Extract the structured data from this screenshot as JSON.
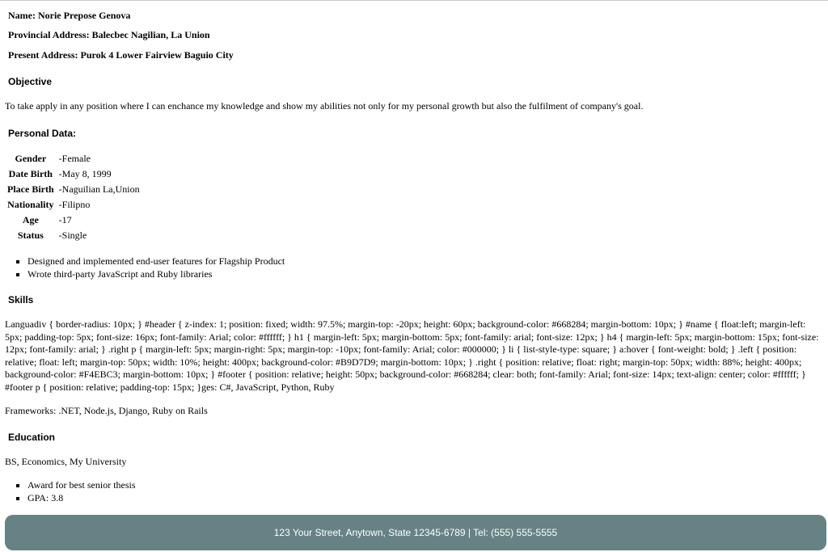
{
  "header": {
    "name": "Name: Norie Prepose Genova",
    "provincial_address": "Provincial Address: Balecbec Nagilian, La Union",
    "present_address": "Present Address: Purok 4 Lower Fairview Baguio City"
  },
  "objective": {
    "title": "Objective",
    "text": "To take apply in any position where I can enchance my knowledge and show my abilities not only for my personal growth but also the fulfilment of company's goal."
  },
  "personal": {
    "title": "Personal Data:",
    "rows": [
      {
        "label": "Gender",
        "value": "-Female"
      },
      {
        "label": "Date Birth",
        "value": "-May 8, 1999"
      },
      {
        "label": "Place Birth",
        "value": "-Naguilian La,Union"
      },
      {
        "label": "Nationality",
        "value": "-Filipno"
      },
      {
        "label": "Age",
        "value": "-17"
      },
      {
        "label": "Status",
        "value": "-Single"
      }
    ],
    "bullets": [
      "Designed and implemented end-user features for Flagship Product",
      "Wrote third-party JavaScript and Ruby libraries"
    ]
  },
  "skills": {
    "title": "Skills",
    "languages_text": "Languadiv { border-radius: 10px; } #header { z-index: 1; position: fixed; width: 97.5%; margin-top: -20px; height: 60px; background-color: #668284; margin-bottom: 10px; } #name { float:left; margin-left: 5px; padding-top: 5px; font-size: 16px; font-family: Arial; color: #ffffff; } h1 { margin-left: 5px; margin-bottom: 5px; font-family: arial; font-size: 12px; } h4 { margin-left: 5px; margin-bottom: 15px; font-size: 12px; font-family: arial; } .right p { margin-left: 5px; margin-right: 5px; margin-top: -10px; font-family: Arial; color: #000000; } li { list-style-type: square; } a:hover { font-weight: bold; } .left { position: relative; float: left; margin-top: 50px; width: 10%; height: 400px; background-color: #B9D7D9; margin-bottom: 10px; } .right { position: relative; float: right; margin-top: 50px; width: 88%; height: 400px; background-color: #F4EBC3; margin-bottom: 10px; } #footer { position: relative; height: 50px; background-color: #668284; clear: both; font-family: Arial; font-size: 14px; text-align: center; color: #ffffff; } #footer p { position: relative; padding-top: 15px; }ges: C#, JavaScript, Python, Ruby",
    "frameworks_text": "Frameworks: .NET, Node.js, Django, Ruby on Rails"
  },
  "education": {
    "title": "Education",
    "degree": "BS, Economics, My University",
    "bullets": [
      "Award for best senior thesis",
      "GPA: 3.8"
    ]
  },
  "footer": {
    "text": "123 Your Street, Anytown, State 12345-6789 | Tel: (555) 555-5555"
  },
  "colors": {
    "footer_bg": "#668284",
    "footer_text": "#ffffff"
  }
}
